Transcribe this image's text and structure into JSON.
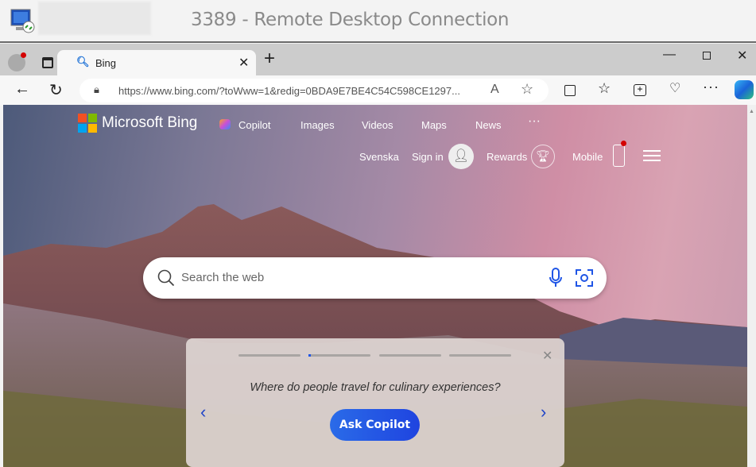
{
  "window": {
    "title": "3389 - Remote Desktop Connection"
  },
  "browser": {
    "tab": {
      "title": "Bing"
    },
    "url": "https://www.bing.com/?toWww=1&redig=0BDA9E7BE4C54C598CE1297..."
  },
  "bing": {
    "brand": "Microsoft Bing",
    "nav": [
      "Copilot",
      "Images",
      "Videos",
      "Maps",
      "News"
    ],
    "language": "Svenska",
    "sign_in": "Sign in",
    "rewards": "Rewards",
    "mobile": "Mobile",
    "search_placeholder": "Search the web",
    "card": {
      "question": "Where do people travel for culinary experiences?",
      "button": "Ask Copilot",
      "active_step": 2,
      "steps": 4
    }
  },
  "colors": {
    "accent": "#1f55e6",
    "notification": "#d40000"
  }
}
